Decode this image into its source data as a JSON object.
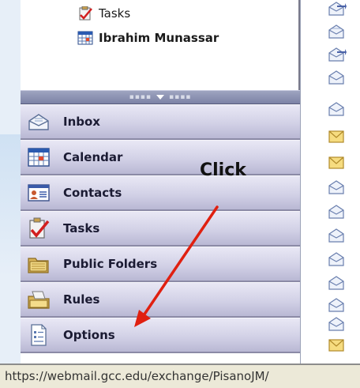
{
  "folder_tree": {
    "items": [
      {
        "label": "Tasks",
        "icon": "tasks-icon",
        "bold": false
      },
      {
        "label": "Ibrahim Munassar",
        "icon": "calendar-icon",
        "bold": true
      }
    ]
  },
  "splitter": {
    "icon": "expand-splitter-icon"
  },
  "navigation": {
    "buttons": [
      {
        "label": "Inbox",
        "icon": "inbox-icon"
      },
      {
        "label": "Calendar",
        "icon": "calendar-icon"
      },
      {
        "label": "Contacts",
        "icon": "contacts-icon"
      },
      {
        "label": "Tasks",
        "icon": "tasks-icon"
      },
      {
        "label": "Public Folders",
        "icon": "public-folders-icon"
      },
      {
        "label": "Rules",
        "icon": "rules-icon"
      },
      {
        "label": "Options",
        "icon": "options-icon"
      }
    ]
  },
  "message_icons": [
    "reply-envelope-icon",
    "open-envelope-icon",
    "reply-envelope-icon",
    "open-envelope-icon",
    "open-envelope-icon",
    "closed-envelope-icon",
    "closed-envelope-icon",
    "open-envelope-icon",
    "open-envelope-icon",
    "open-envelope-icon",
    "open-envelope-icon",
    "open-envelope-icon",
    "open-envelope-icon",
    "open-envelope-icon",
    "closed-envelope-icon"
  ],
  "annotation": {
    "text": "Click",
    "color": "#e02010"
  },
  "status_bar": {
    "url": "https://webmail.gcc.edu/exchange/PisanoJM/"
  },
  "colors": {
    "nav_gradient_top": "#e9e8f5",
    "nav_gradient_bottom": "#b9b8d4",
    "splitter": "#8c91b0",
    "arrow": "#e02010"
  }
}
